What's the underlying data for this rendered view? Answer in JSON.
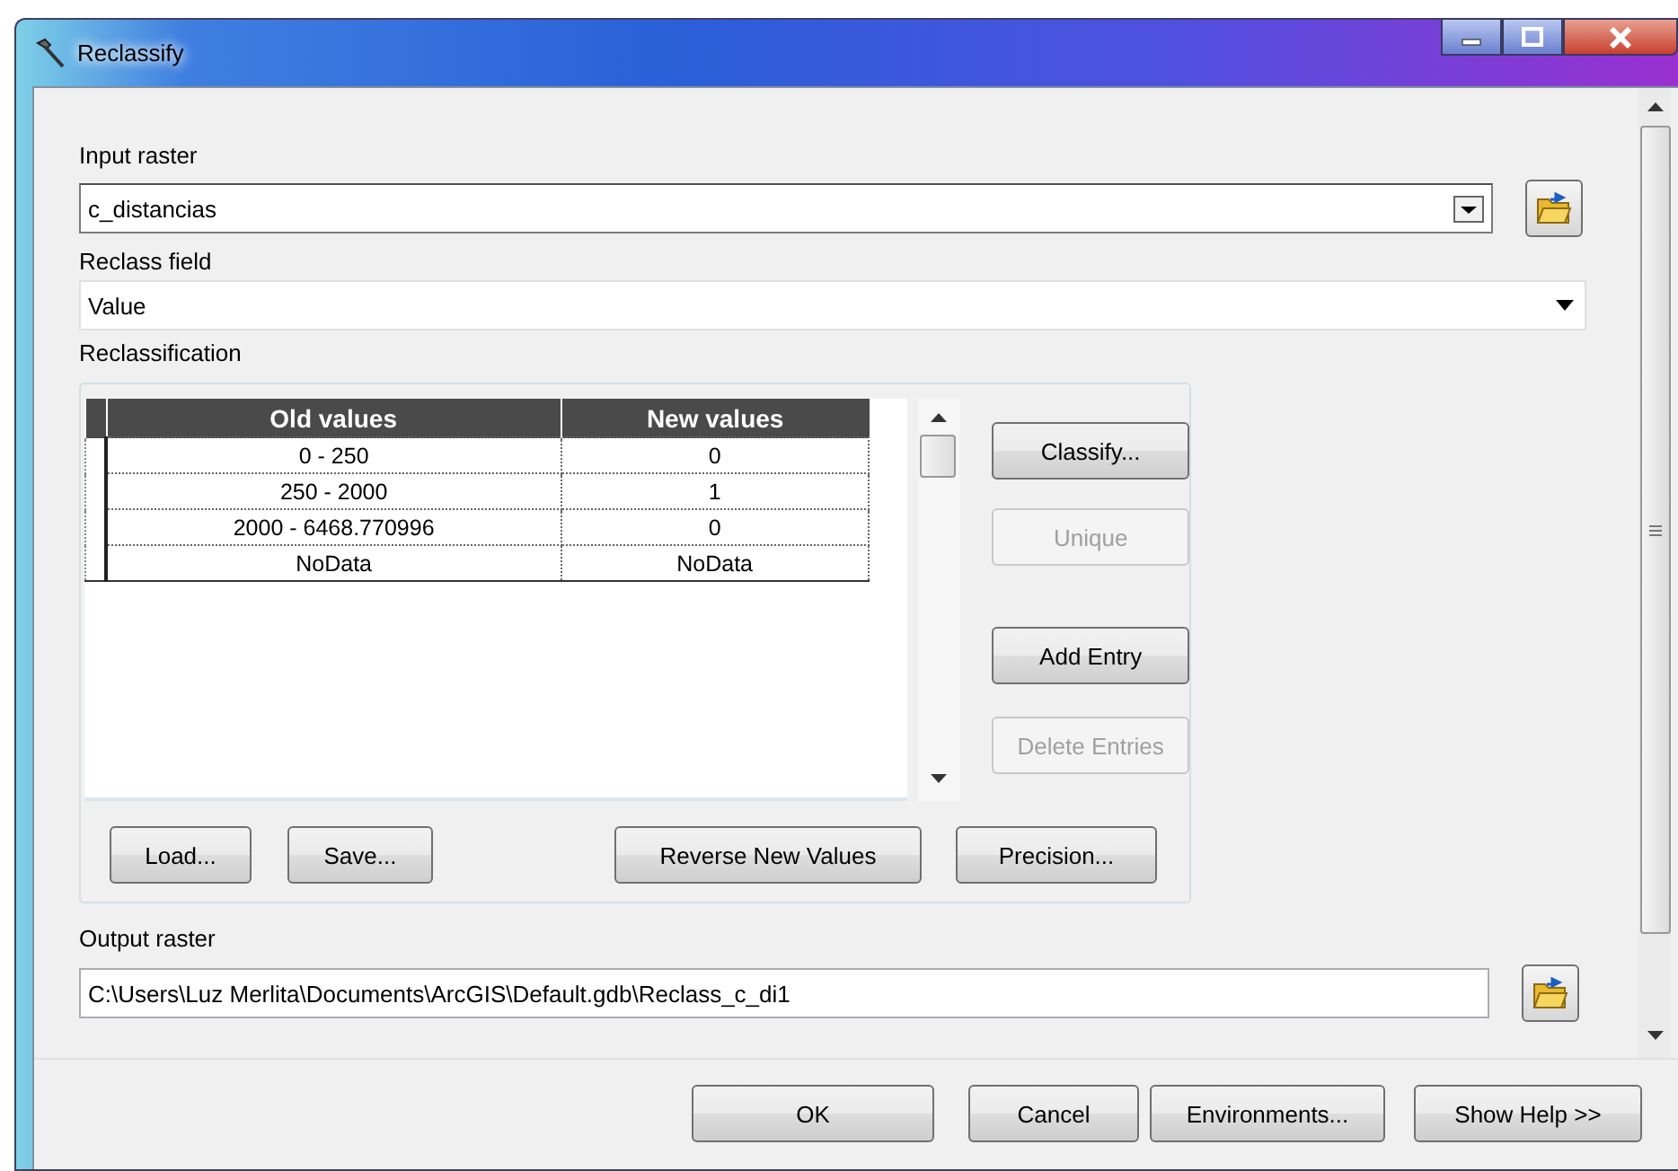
{
  "window": {
    "title": "Reclassify"
  },
  "input_raster": {
    "label": "Input raster",
    "value": "c_distancias"
  },
  "reclass_field": {
    "label": "Reclass field",
    "value": "Value"
  },
  "reclassification": {
    "label": "Reclassification",
    "columns": [
      "Old values",
      "New values"
    ],
    "rows": [
      {
        "old": "0 - 250",
        "new": "0"
      },
      {
        "old": "250 - 2000",
        "new": "1"
      },
      {
        "old": "2000 - 6468.770996",
        "new": "0"
      },
      {
        "old": "NoData",
        "new": "NoData"
      }
    ],
    "side_buttons": [
      {
        "label": "Classify...",
        "disabled": false
      },
      {
        "label": "Unique",
        "disabled": true
      },
      {
        "label": "Add Entry",
        "disabled": false
      },
      {
        "label": "Delete Entries",
        "disabled": true
      }
    ],
    "bottom_buttons": [
      {
        "label": "Load...",
        "disabled": false
      },
      {
        "label": "Save...",
        "disabled": false
      },
      {
        "label": "Reverse New Values",
        "disabled": false
      },
      {
        "label": "Precision...",
        "disabled": false
      }
    ]
  },
  "output_raster": {
    "label": "Output raster",
    "value": "C:\\Users\\Luz Merlita\\Documents\\ArcGIS\\Default.gdb\\Reclass_c_di1"
  },
  "dialog_buttons": [
    {
      "label": "OK"
    },
    {
      "label": "Cancel"
    },
    {
      "label": "Environments..."
    },
    {
      "label": "Show Help >>"
    }
  ]
}
